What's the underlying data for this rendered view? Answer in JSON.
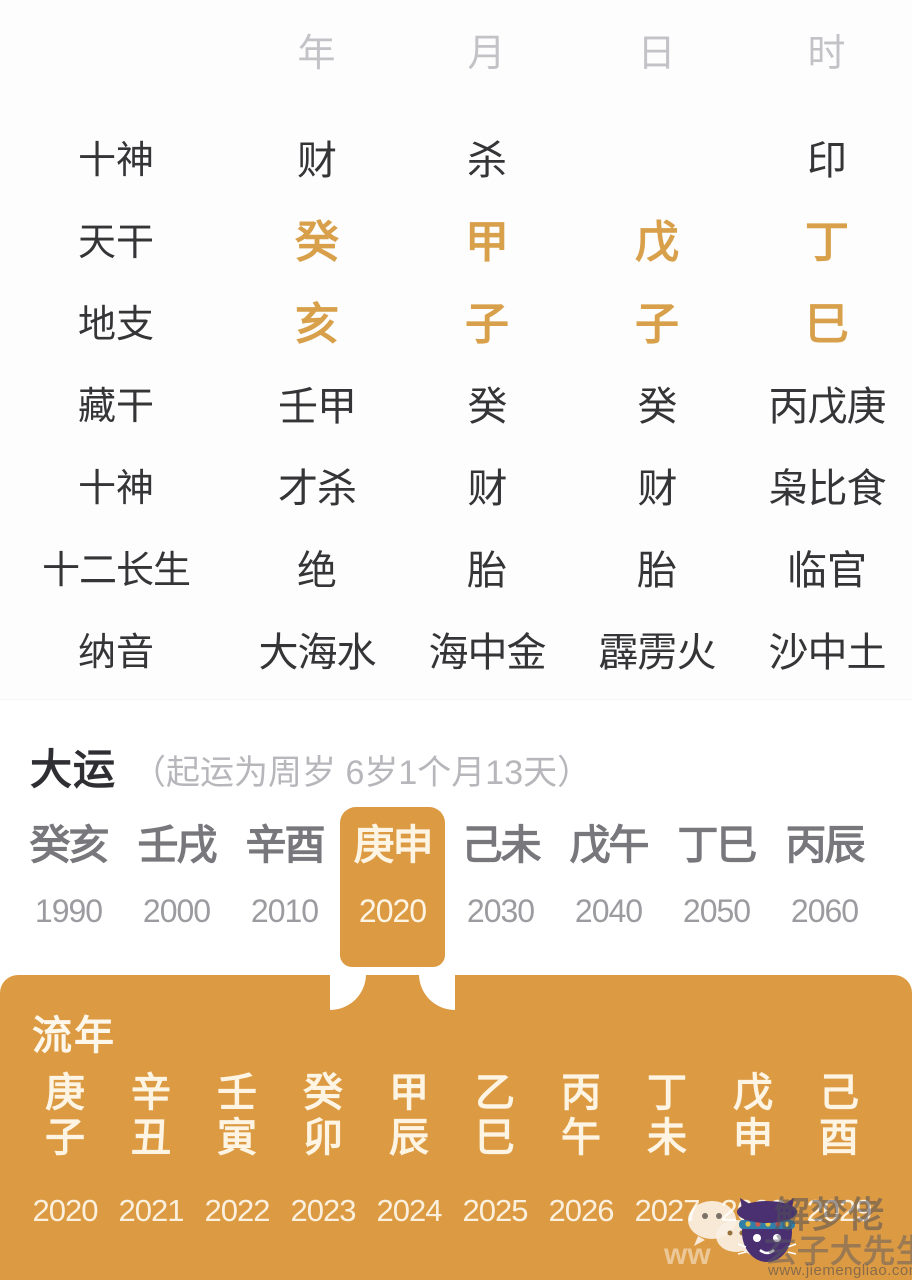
{
  "bazi_table": {
    "pillar_headers": [
      "年",
      "月",
      "日",
      "时"
    ],
    "rows": [
      {
        "label": "十神",
        "style": "dark",
        "values": [
          "财",
          "杀",
          "",
          "印"
        ]
      },
      {
        "label": "天干",
        "style": "gold",
        "values": [
          "癸",
          "甲",
          "戊",
          "丁"
        ]
      },
      {
        "label": "地支",
        "style": "gold",
        "values": [
          "亥",
          "子",
          "子",
          "巳"
        ]
      },
      {
        "label": "藏干",
        "style": "dark",
        "values": [
          "壬甲",
          "癸",
          "癸",
          "丙戊庚"
        ]
      },
      {
        "label": "十神",
        "style": "dark",
        "values": [
          "才杀",
          "财",
          "财",
          "枭比食"
        ]
      },
      {
        "label": "十二长生",
        "style": "dark",
        "values": [
          "绝",
          "胎",
          "胎",
          "临官"
        ]
      },
      {
        "label": "纳音",
        "style": "dark",
        "values": [
          "大海水",
          "海中金",
          "霹雳火",
          "沙中土"
        ]
      }
    ]
  },
  "dayun": {
    "title": "大运",
    "note": "（起运为周岁 6岁1个月13天）",
    "active_index": 3,
    "items": [
      {
        "ganzhi": "癸亥",
        "year": "1990"
      },
      {
        "ganzhi": "壬戌",
        "year": "2000"
      },
      {
        "ganzhi": "辛酉",
        "year": "2010"
      },
      {
        "ganzhi": "庚申",
        "year": "2020"
      },
      {
        "ganzhi": "己未",
        "year": "2030"
      },
      {
        "ganzhi": "戊午",
        "year": "2040"
      },
      {
        "ganzhi": "丁巳",
        "year": "2050"
      },
      {
        "ganzhi": "丙辰",
        "year": "2060"
      }
    ]
  },
  "liunian": {
    "title": "流年",
    "items": [
      {
        "gan": "庚",
        "zhi": "子",
        "year": "2020"
      },
      {
        "gan": "辛",
        "zhi": "丑",
        "year": "2021"
      },
      {
        "gan": "壬",
        "zhi": "寅",
        "year": "2022"
      },
      {
        "gan": "癸",
        "zhi": "卯",
        "year": "2023"
      },
      {
        "gan": "甲",
        "zhi": "辰",
        "year": "2024"
      },
      {
        "gan": "乙",
        "zhi": "巳",
        "year": "2025"
      },
      {
        "gan": "丙",
        "zhi": "午",
        "year": "2026"
      },
      {
        "gan": "丁",
        "zhi": "未",
        "year": "2027"
      },
      {
        "gan": "戊",
        "zhi": "申",
        "year": "2028"
      },
      {
        "gan": "己",
        "zhi": "酉",
        "year": "2029"
      }
    ]
  },
  "watermark": {
    "brand": "解梦佬",
    "sub": "玄子大先生",
    "url": "www.jiemengliao.com",
    "side": "ww"
  },
  "colors": {
    "gold_text": "#d8a04a",
    "panel_orange": "#dc9a42",
    "cream": "#fdf4e3",
    "dark_text": "#353538",
    "muted_text": "#b6b6bb"
  }
}
